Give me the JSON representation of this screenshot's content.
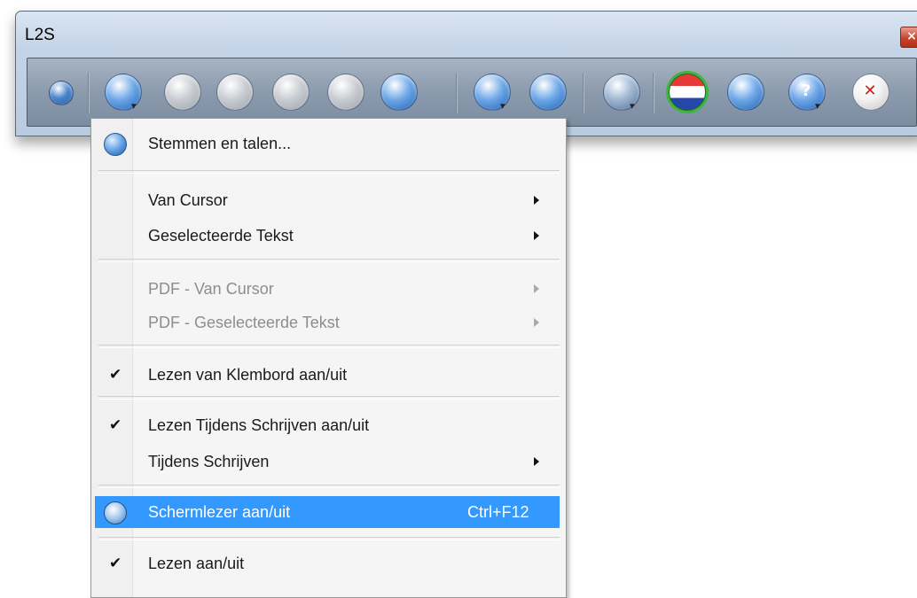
{
  "window": {
    "title": "L2S",
    "close_glyph": "×"
  },
  "toolbar": {
    "buttons": [
      {
        "name": "swap-icon",
        "colors": [
          "#4a86cf",
          "#2d5a99"
        ]
      },
      {
        "name": "speech-bubble-dropdown-icon",
        "colors": [
          "#6fa8e8",
          "#1e5fb0"
        ]
      },
      {
        "name": "skip-back-icon",
        "colors": [
          "#c8ccd2",
          "#9aa1aa"
        ]
      },
      {
        "name": "play-icon",
        "colors": [
          "#c8ccd2",
          "#9aa1aa"
        ]
      },
      {
        "name": "pause-icon",
        "colors": [
          "#c8ccd2",
          "#9aa1aa"
        ]
      },
      {
        "name": "stop-icon",
        "colors": [
          "#c8ccd2",
          "#9aa1aa"
        ]
      },
      {
        "name": "download-icon",
        "colors": [
          "#6fa8e8",
          "#1e5fb0"
        ]
      },
      {
        "name": "document-dropdown-icon",
        "colors": [
          "#6fa8e8",
          "#1e5fb0"
        ]
      },
      {
        "name": "document-power-icon",
        "colors": [
          "#6fa8e8",
          "#1e5fb0"
        ]
      },
      {
        "name": "pen-dropdown-icon",
        "colors": [
          "#9fb7d3",
          "#4d6b91"
        ]
      },
      {
        "name": "dutch-flag-icon",
        "colors": [
          "#ff4040",
          "#1f3fa8"
        ]
      },
      {
        "name": "wrench-icon",
        "colors": [
          "#6fa8e8",
          "#1e5fb0"
        ]
      },
      {
        "name": "help-dropdown-icon",
        "colors": [
          "#6fa8e8",
          "#1e5fb0"
        ]
      },
      {
        "name": "exit-icon",
        "colors": [
          "#f2f2f2",
          "#c2c2c2"
        ]
      }
    ],
    "help_glyph": "?",
    "exit_glyph": "✕",
    "dropdown_glyph": "▾"
  },
  "menu": {
    "items": [
      {
        "label": "Stemmen en talen...",
        "icon": "voices-icon"
      },
      {
        "label": "Van Cursor",
        "submenu": true
      },
      {
        "label": "Geselecteerde Tekst",
        "submenu": true
      },
      {
        "label": "PDF - Van Cursor",
        "submenu": true,
        "disabled": true
      },
      {
        "label": "PDF - Geselecteerde Tekst",
        "submenu": true,
        "disabled": true
      },
      {
        "label": "Lezen van Klembord aan/uit",
        "checked": true
      },
      {
        "label": "Lezen Tijdens Schrijven aan/uit",
        "checked": true
      },
      {
        "label": "Tijdens Schrijven",
        "submenu": true
      },
      {
        "label": "Schermlezer aan/uit",
        "shortcut": "Ctrl+F12",
        "highlighted": true,
        "icon": "screen-reader-icon"
      },
      {
        "label": "Lezen aan/uit",
        "checked": true
      }
    ],
    "check_glyph": "✔",
    "highlight_color": "#3399ff"
  }
}
